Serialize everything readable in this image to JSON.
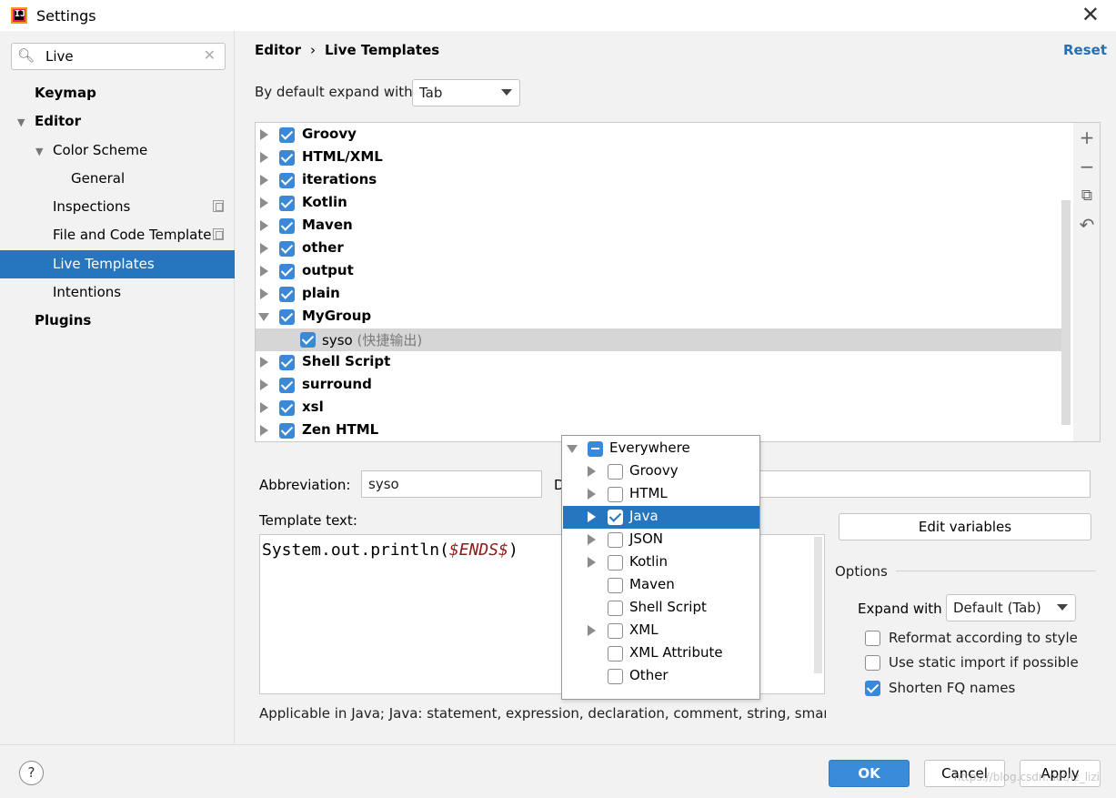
{
  "window": {
    "title": "Settings",
    "app_icon_text": "IJ"
  },
  "search": {
    "value": "Live",
    "icon": "search-icon",
    "clear_icon": "clear-icon"
  },
  "sidebar": {
    "items": [
      {
        "label": "Keymap"
      },
      {
        "label": "Editor"
      },
      {
        "label": "Color Scheme"
      },
      {
        "label": "General"
      },
      {
        "label": "Inspections"
      },
      {
        "label": "File and Code Template"
      },
      {
        "label": "Live Templates"
      },
      {
        "label": "Intentions"
      },
      {
        "label": "Plugins"
      }
    ]
  },
  "header": {
    "breadcrumb": [
      "Editor",
      "›",
      "Live Templates"
    ],
    "reset": "Reset"
  },
  "expand_default": {
    "label": "By default expand with",
    "value": "Tab"
  },
  "templates": {
    "groups": [
      {
        "name": "Groovy"
      },
      {
        "name": "HTML/XML"
      },
      {
        "name": "iterations"
      },
      {
        "name": "Kotlin"
      },
      {
        "name": "Maven"
      },
      {
        "name": "other"
      },
      {
        "name": "output"
      },
      {
        "name": "plain"
      },
      {
        "name": "MyGroup"
      },
      {
        "name": "syso",
        "desc": "(快捷输出)"
      },
      {
        "name": "Shell Script"
      },
      {
        "name": "surround"
      },
      {
        "name": "xsl"
      },
      {
        "name": "Zen HTML"
      }
    ],
    "tools": [
      "+",
      "−",
      "⧉",
      "↶"
    ]
  },
  "abbreviation": {
    "label": "Abbreviation:",
    "value": "syso"
  },
  "description": {
    "label": "D"
  },
  "template_text": {
    "label": "Template text:",
    "code_prefix": "System.out.println(",
    "code_var": "$ENDS$",
    "code_suffix": ")"
  },
  "applicable": "Applicable in Java; Java: statement, expression, declaration, comment, string, smart typ",
  "edit_variables": "Edit variables",
  "options": {
    "title": "Options",
    "expand_with_label": "Expand with",
    "expand_with_value": "Default (Tab)",
    "reformat": "Reformat according to style",
    "static_import": "Use static import if possible",
    "shorten_fq": "Shorten FQ names"
  },
  "context_popup": {
    "items": [
      {
        "label": "Everywhere"
      },
      {
        "label": "Groovy"
      },
      {
        "label": "HTML"
      },
      {
        "label": "Java"
      },
      {
        "label": "JSON"
      },
      {
        "label": "Kotlin"
      },
      {
        "label": "Maven"
      },
      {
        "label": "Shell Script"
      },
      {
        "label": "XML"
      },
      {
        "label": "XML Attribute"
      },
      {
        "label": "Other"
      }
    ]
  },
  "footer": {
    "help": "?",
    "ok": "OK",
    "cancel": "Cancel",
    "apply": "Apply",
    "watermark": "https://blog.csdn.net/lz_lizi"
  },
  "colors": {
    "accent": "#2675bf",
    "checkbox": "#3a89d9",
    "reset_link": "#2470b3"
  }
}
